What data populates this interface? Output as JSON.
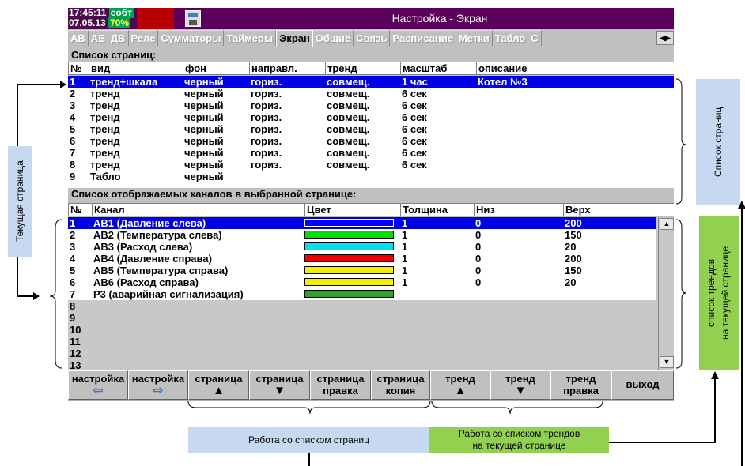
{
  "status": {
    "time": "17:45:11",
    "mode": "собт",
    "date": "07.05.13",
    "percent": "70%"
  },
  "window": {
    "title": "Настройка - Экран"
  },
  "tabs": [
    "АВ",
    "АЕ",
    "ДВ",
    "Реле",
    "Сумматоры",
    "Таймеры",
    "Экран",
    "Общие",
    "Связь",
    "Расписание",
    "Метки",
    "Табло",
    "С"
  ],
  "active_tab": "Экран",
  "pages": {
    "section_title": "Список страниц:",
    "columns": [
      "№",
      "вид",
      "фон",
      "направл.",
      "тренд",
      "масштаб",
      "описание"
    ],
    "rows": [
      [
        "1",
        "тренд+шкала",
        "черный",
        "гориз.",
        "совмещ.",
        "1 час",
        "Котел №3"
      ],
      [
        "2",
        "тренд",
        "черный",
        "гориз.",
        "совмещ.",
        "6 сек",
        ""
      ],
      [
        "3",
        "тренд",
        "черный",
        "гориз.",
        "совмещ.",
        "6 сек",
        ""
      ],
      [
        "4",
        "тренд",
        "черный",
        "гориз.",
        "совмещ.",
        "6 сек",
        ""
      ],
      [
        "5",
        "тренд",
        "черный",
        "гориз.",
        "совмещ.",
        "6 сек",
        ""
      ],
      [
        "6",
        "тренд",
        "черный",
        "гориз.",
        "совмещ.",
        "6 сек",
        ""
      ],
      [
        "7",
        "тренд",
        "черный",
        "гориз.",
        "совмещ.",
        "6 сек",
        ""
      ],
      [
        "8",
        "тренд",
        "черный",
        "гориз.",
        "совмещ.",
        "6 сек",
        ""
      ],
      [
        "9",
        "Табло",
        "черный",
        "",
        "",
        "",
        ""
      ]
    ],
    "selected_row": 0
  },
  "channels": {
    "section_title": "Список отображаемых каналов в выбранной странице:",
    "columns": [
      "№",
      "Канал",
      "Цвет",
      "Толщина",
      "Низ",
      "Верх"
    ],
    "rows": [
      {
        "n": "1",
        "name": "АВ1 (Давление слева)",
        "color": "#0000ff",
        "width": "1",
        "low": "0",
        "high": "200"
      },
      {
        "n": "2",
        "name": "АВ2 (Температура слева)",
        "color": "#00e000",
        "width": "1",
        "low": "0",
        "high": "150"
      },
      {
        "n": "3",
        "name": "АВ3 (Расход слева)",
        "color": "#00e0f0",
        "width": "1",
        "low": "0",
        "high": "20"
      },
      {
        "n": "4",
        "name": "АВ4 (Давление справа)",
        "color": "#f00000",
        "width": "1",
        "low": "0",
        "high": "200"
      },
      {
        "n": "5",
        "name": "АВ5 (Температура справа)",
        "color": "#f0f000",
        "width": "1",
        "low": "0",
        "high": "150"
      },
      {
        "n": "6",
        "name": "АВ6 (Расход справа)",
        "color": "#f0f000",
        "width": "1",
        "low": "0",
        "high": "20"
      },
      {
        "n": "7",
        "name": "Р3 (аварийная сигнализация)",
        "color": "#30a030",
        "width": "",
        "low": "",
        "high": ""
      }
    ],
    "empty_rows": [
      "8",
      "9",
      "10",
      "11",
      "12",
      "13"
    ],
    "selected_row": 0
  },
  "toolbar": [
    {
      "line1": "настройка",
      "icon": "⇦",
      "blue": true,
      "name": "settings-prev-button"
    },
    {
      "line1": "настройка",
      "icon": "⇨",
      "blue": true,
      "name": "settings-next-button"
    },
    {
      "line1": "страница",
      "icon": "▲",
      "blue": false,
      "name": "page-up-button"
    },
    {
      "line1": "страница",
      "icon": "▼",
      "blue": false,
      "name": "page-down-button"
    },
    {
      "line1": "страница",
      "line2": "правка",
      "name": "page-edit-button"
    },
    {
      "line1": "страница",
      "line2": "копия",
      "name": "page-copy-button"
    },
    {
      "line1": "тренд",
      "icon": "▲",
      "blue": false,
      "name": "trend-up-button"
    },
    {
      "line1": "тренд",
      "icon": "▼",
      "blue": false,
      "name": "trend-down-button"
    },
    {
      "line1": "тренд",
      "line2": "правка",
      "name": "trend-edit-button"
    },
    {
      "line1": "выход",
      "name": "exit-button"
    }
  ],
  "annotations": {
    "current_page": "Текущая страница",
    "page_list": "Список страниц",
    "trend_list_line1": "список трендов",
    "trend_list_line2": "на текущей странице",
    "work_pages": "Работа со списком страниц",
    "work_trends_line1": "Работа со списком трендов",
    "work_trends_line2": "на текущей странице"
  },
  "colors": {
    "selection": "#0000e8",
    "titlebar": "#5a005a",
    "callout_blue": "#c6d9f1",
    "callout_green": "#92d050"
  }
}
